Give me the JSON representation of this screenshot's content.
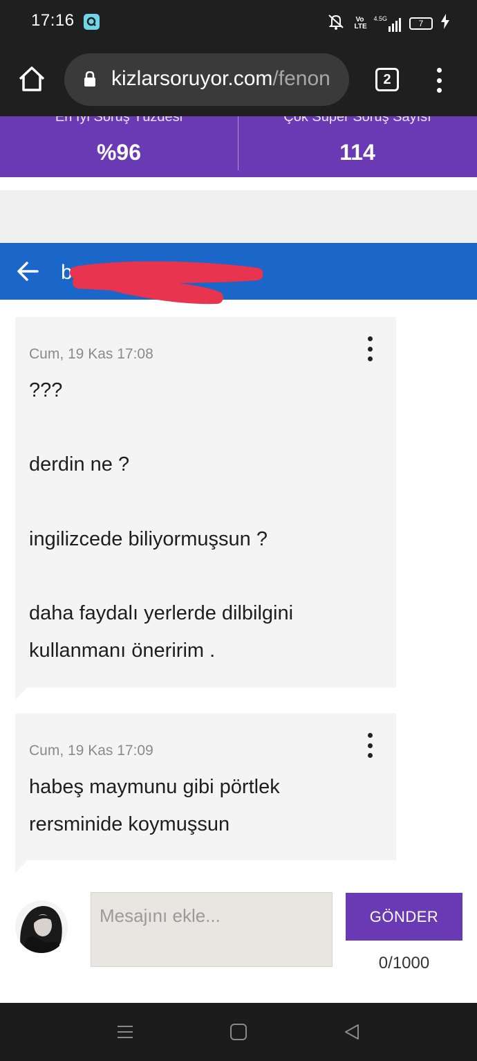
{
  "status_bar": {
    "time": "17:16",
    "app_icon": "search-app-icon",
    "network_label": "4.5G",
    "volte_label": "Vo LTE",
    "battery_level": "7",
    "icons": [
      "mute-icon",
      "volte-icon",
      "signal-icon",
      "battery-icon",
      "charging-icon"
    ]
  },
  "browser": {
    "url_domain": "kizlarsoruyor.com",
    "url_path": "/fenon",
    "tab_count": "2",
    "icons": [
      "home-icon",
      "lock-icon",
      "overflow-menu-icon"
    ]
  },
  "stats": {
    "left": {
      "label": "En İyi Soruş Yüzdesi",
      "value": "%96"
    },
    "right": {
      "label": "Çok Süper Soruş Sayısı",
      "value": "114"
    }
  },
  "conversation": {
    "name_visible": "b",
    "back_icon": "arrow-left-icon"
  },
  "messages": [
    {
      "time": "Cum, 19 Kas 17:08",
      "lines": [
        "???",
        "derdin ne ?",
        "ingilizcede biliyormuşsun ?",
        "daha faydalı yerlerde dilbilgini",
        "kullanmanı öneririm ."
      ]
    },
    {
      "time": "Cum, 19 Kas 17:09",
      "lines": [
        "habeş maymunu gibi pörtlek",
        "rersminide koymuşsun"
      ]
    }
  ],
  "composer": {
    "placeholder": "Mesajını ekle...",
    "send_label": "GÖNDER",
    "counter": "0/1000"
  },
  "colors": {
    "purple": "#6a3ab5",
    "blue_header": "#1a66c9",
    "chrome_dark": "#1f1f1f",
    "bubble_bg": "#f4f4f4",
    "redaction": "#e8344e"
  },
  "navbar": {
    "icons": [
      "recents-icon",
      "home-square-icon",
      "back-triangle-icon"
    ]
  }
}
